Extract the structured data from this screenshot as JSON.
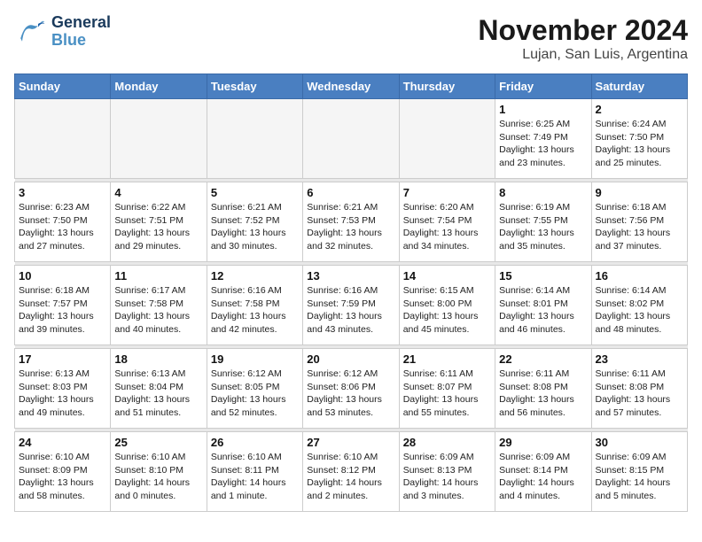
{
  "header": {
    "logo_line1": "General",
    "logo_line2": "Blue",
    "title": "November 2024",
    "subtitle": "Lujan, San Luis, Argentina"
  },
  "weekdays": [
    "Sunday",
    "Monday",
    "Tuesday",
    "Wednesday",
    "Thursday",
    "Friday",
    "Saturday"
  ],
  "weeks": [
    [
      {
        "day": "",
        "detail": ""
      },
      {
        "day": "",
        "detail": ""
      },
      {
        "day": "",
        "detail": ""
      },
      {
        "day": "",
        "detail": ""
      },
      {
        "day": "",
        "detail": ""
      },
      {
        "day": "1",
        "detail": "Sunrise: 6:25 AM\nSunset: 7:49 PM\nDaylight: 13 hours\nand 23 minutes."
      },
      {
        "day": "2",
        "detail": "Sunrise: 6:24 AM\nSunset: 7:50 PM\nDaylight: 13 hours\nand 25 minutes."
      }
    ],
    [
      {
        "day": "3",
        "detail": "Sunrise: 6:23 AM\nSunset: 7:50 PM\nDaylight: 13 hours\nand 27 minutes."
      },
      {
        "day": "4",
        "detail": "Sunrise: 6:22 AM\nSunset: 7:51 PM\nDaylight: 13 hours\nand 29 minutes."
      },
      {
        "day": "5",
        "detail": "Sunrise: 6:21 AM\nSunset: 7:52 PM\nDaylight: 13 hours\nand 30 minutes."
      },
      {
        "day": "6",
        "detail": "Sunrise: 6:21 AM\nSunset: 7:53 PM\nDaylight: 13 hours\nand 32 minutes."
      },
      {
        "day": "7",
        "detail": "Sunrise: 6:20 AM\nSunset: 7:54 PM\nDaylight: 13 hours\nand 34 minutes."
      },
      {
        "day": "8",
        "detail": "Sunrise: 6:19 AM\nSunset: 7:55 PM\nDaylight: 13 hours\nand 35 minutes."
      },
      {
        "day": "9",
        "detail": "Sunrise: 6:18 AM\nSunset: 7:56 PM\nDaylight: 13 hours\nand 37 minutes."
      }
    ],
    [
      {
        "day": "10",
        "detail": "Sunrise: 6:18 AM\nSunset: 7:57 PM\nDaylight: 13 hours\nand 39 minutes."
      },
      {
        "day": "11",
        "detail": "Sunrise: 6:17 AM\nSunset: 7:58 PM\nDaylight: 13 hours\nand 40 minutes."
      },
      {
        "day": "12",
        "detail": "Sunrise: 6:16 AM\nSunset: 7:58 PM\nDaylight: 13 hours\nand 42 minutes."
      },
      {
        "day": "13",
        "detail": "Sunrise: 6:16 AM\nSunset: 7:59 PM\nDaylight: 13 hours\nand 43 minutes."
      },
      {
        "day": "14",
        "detail": "Sunrise: 6:15 AM\nSunset: 8:00 PM\nDaylight: 13 hours\nand 45 minutes."
      },
      {
        "day": "15",
        "detail": "Sunrise: 6:14 AM\nSunset: 8:01 PM\nDaylight: 13 hours\nand 46 minutes."
      },
      {
        "day": "16",
        "detail": "Sunrise: 6:14 AM\nSunset: 8:02 PM\nDaylight: 13 hours\nand 48 minutes."
      }
    ],
    [
      {
        "day": "17",
        "detail": "Sunrise: 6:13 AM\nSunset: 8:03 PM\nDaylight: 13 hours\nand 49 minutes."
      },
      {
        "day": "18",
        "detail": "Sunrise: 6:13 AM\nSunset: 8:04 PM\nDaylight: 13 hours\nand 51 minutes."
      },
      {
        "day": "19",
        "detail": "Sunrise: 6:12 AM\nSunset: 8:05 PM\nDaylight: 13 hours\nand 52 minutes."
      },
      {
        "day": "20",
        "detail": "Sunrise: 6:12 AM\nSunset: 8:06 PM\nDaylight: 13 hours\nand 53 minutes."
      },
      {
        "day": "21",
        "detail": "Sunrise: 6:11 AM\nSunset: 8:07 PM\nDaylight: 13 hours\nand 55 minutes."
      },
      {
        "day": "22",
        "detail": "Sunrise: 6:11 AM\nSunset: 8:08 PM\nDaylight: 13 hours\nand 56 minutes."
      },
      {
        "day": "23",
        "detail": "Sunrise: 6:11 AM\nSunset: 8:08 PM\nDaylight: 13 hours\nand 57 minutes."
      }
    ],
    [
      {
        "day": "24",
        "detail": "Sunrise: 6:10 AM\nSunset: 8:09 PM\nDaylight: 13 hours\nand 58 minutes."
      },
      {
        "day": "25",
        "detail": "Sunrise: 6:10 AM\nSunset: 8:10 PM\nDaylight: 14 hours\nand 0 minutes."
      },
      {
        "day": "26",
        "detail": "Sunrise: 6:10 AM\nSunset: 8:11 PM\nDaylight: 14 hours\nand 1 minute."
      },
      {
        "day": "27",
        "detail": "Sunrise: 6:10 AM\nSunset: 8:12 PM\nDaylight: 14 hours\nand 2 minutes."
      },
      {
        "day": "28",
        "detail": "Sunrise: 6:09 AM\nSunset: 8:13 PM\nDaylight: 14 hours\nand 3 minutes."
      },
      {
        "day": "29",
        "detail": "Sunrise: 6:09 AM\nSunset: 8:14 PM\nDaylight: 14 hours\nand 4 minutes."
      },
      {
        "day": "30",
        "detail": "Sunrise: 6:09 AM\nSunset: 8:15 PM\nDaylight: 14 hours\nand 5 minutes."
      }
    ]
  ]
}
